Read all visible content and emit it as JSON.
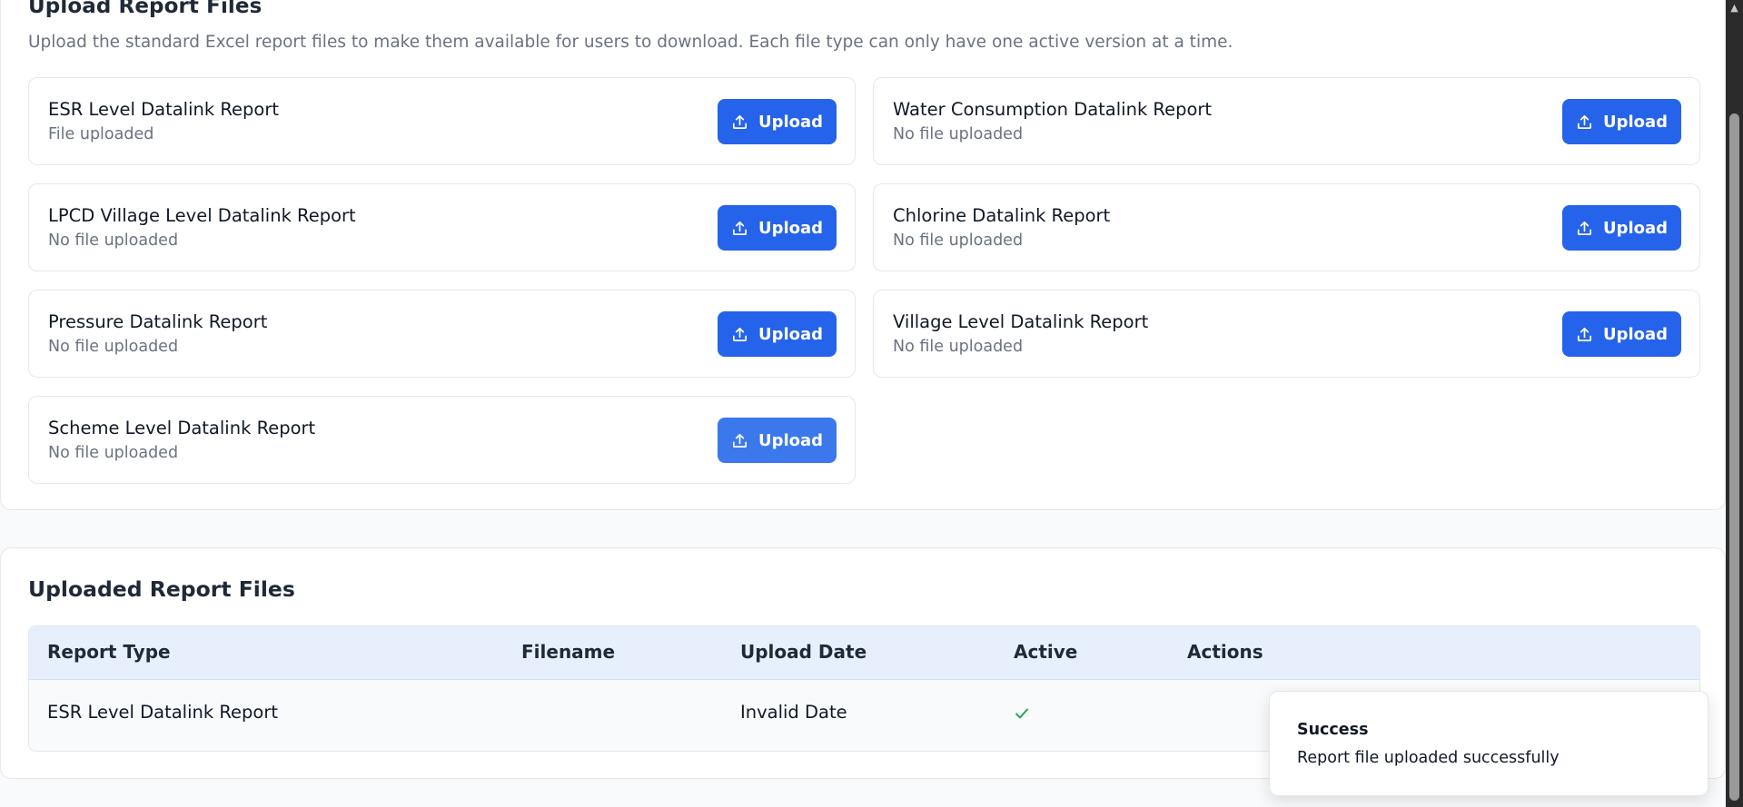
{
  "upload_section": {
    "title": "Upload Report Files",
    "description": "Upload the standard Excel report files to make them available for users to download. Each file type can only have one active version at a time.",
    "button_label": "Upload",
    "items": [
      {
        "name": "ESR Level Datalink Report",
        "status": "File uploaded"
      },
      {
        "name": "Water Consumption Datalink Report",
        "status": "No file uploaded"
      },
      {
        "name": "LPCD Village Level Datalink Report",
        "status": "No file uploaded"
      },
      {
        "name": "Chlorine Datalink Report",
        "status": "No file uploaded"
      },
      {
        "name": "Pressure Datalink Report",
        "status": "No file uploaded"
      },
      {
        "name": "Village Level Datalink Report",
        "status": "No file uploaded"
      },
      {
        "name": "Scheme Level Datalink Report",
        "status": "No file uploaded"
      }
    ]
  },
  "uploaded_section": {
    "title": "Uploaded Report Files",
    "columns": [
      "Report Type",
      "Filename",
      "Upload Date",
      "Active",
      "Actions"
    ],
    "rows": [
      {
        "report_type": "ESR Level Datalink Report",
        "filename": "",
        "upload_date": "Invalid Date",
        "active": true,
        "actions": ""
      }
    ]
  },
  "toast": {
    "title": "Success",
    "message": "Report file uploaded successfully"
  },
  "colors": {
    "primary": "#2563eb",
    "success_check": "#16a34a",
    "table_header_bg": "#e6effb"
  },
  "icons": {
    "upload": "upload-icon",
    "check": "check-icon"
  }
}
